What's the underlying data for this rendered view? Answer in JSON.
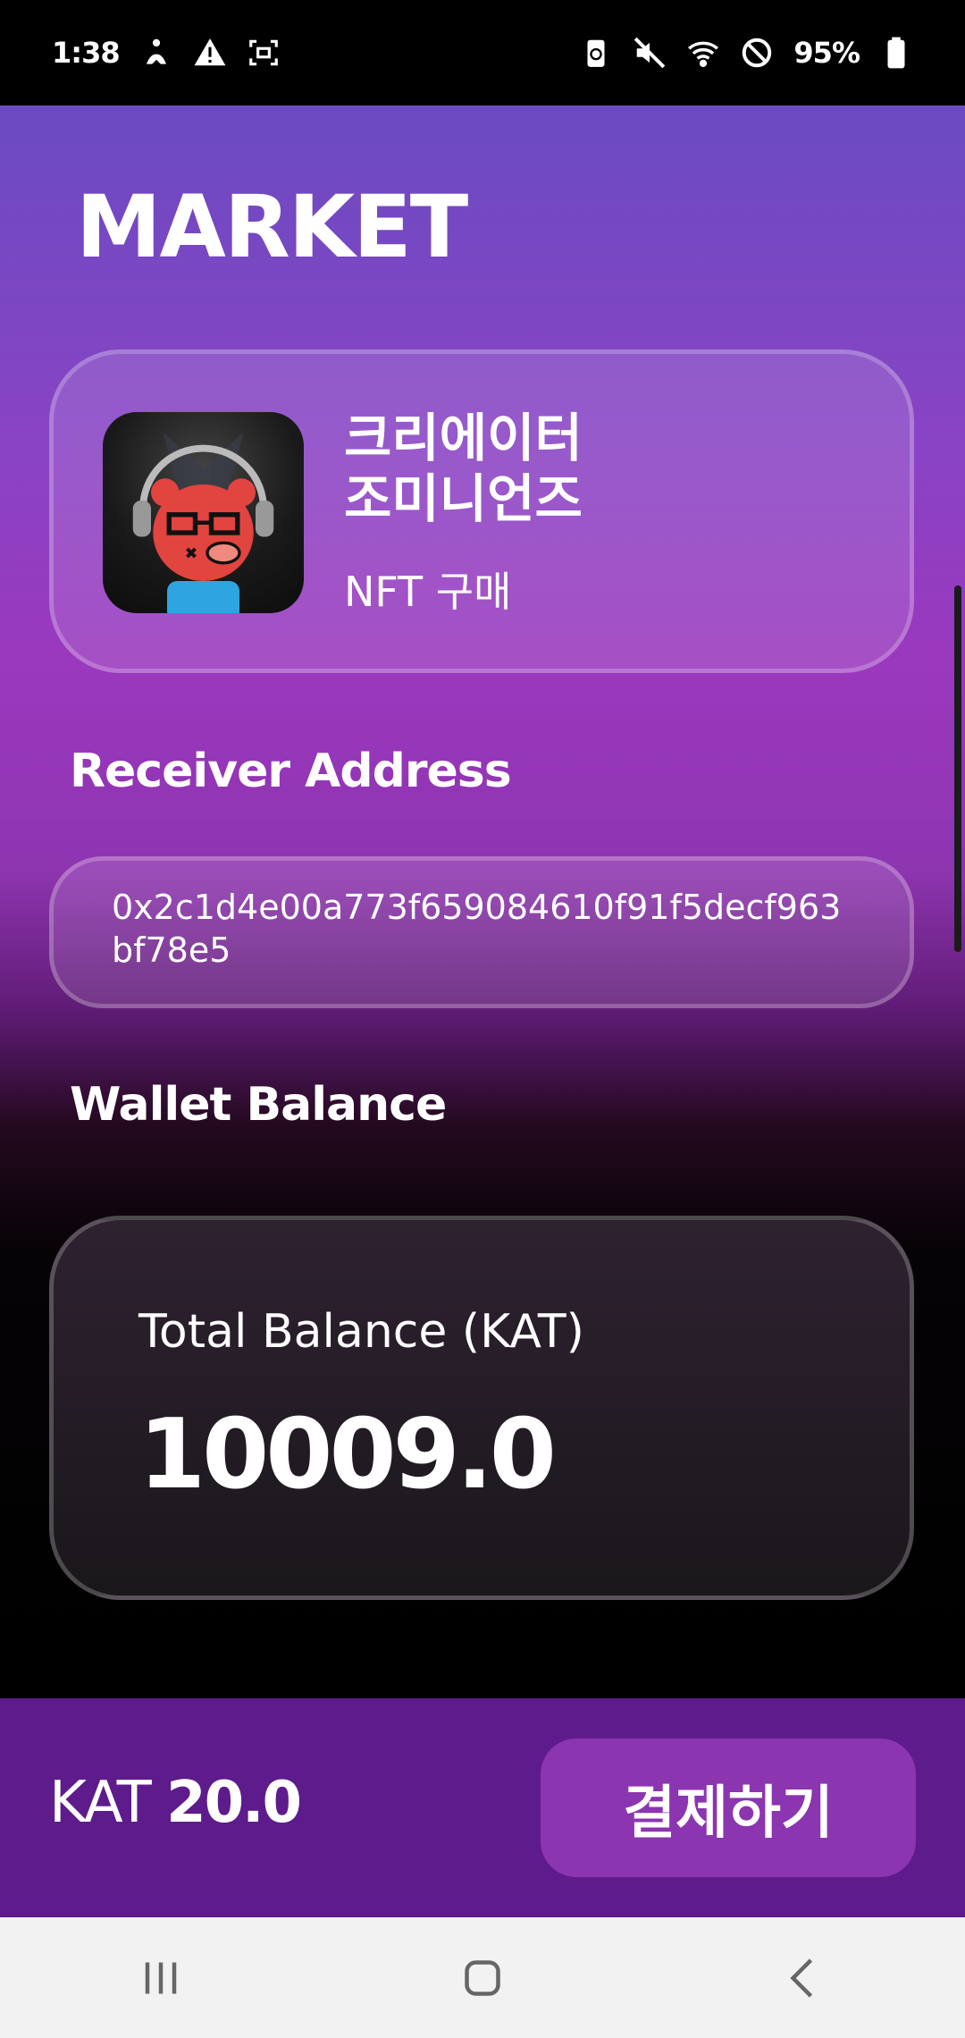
{
  "status_bar": {
    "time": "1:38",
    "battery_percent": "95%",
    "left_icons": [
      "accessibility-icon",
      "warning-icon",
      "screen-record-icon"
    ],
    "right_icons": [
      "battery-saver-icon",
      "mute-icon",
      "wifi-icon",
      "do-not-disturb-icon",
      "battery-icon"
    ]
  },
  "page": {
    "title": "MARKET"
  },
  "product": {
    "name": "크리에이터\n 조미니언즈",
    "subtitle": "NFT 구매",
    "thumbnail_icon": "bear-headphones-avatar-icon"
  },
  "receiver": {
    "label": "Receiver Address",
    "address": "0x2c1d4e00a773f659084610f91f5decf963bf78e5"
  },
  "wallet": {
    "label": "Wallet Balance",
    "caption": "Total Balance (KAT)",
    "value": "10009.0"
  },
  "checkout": {
    "currency": "KAT",
    "amount": "20.0",
    "pay_label": "결제하기"
  },
  "nav": {
    "icons": [
      "recent-apps-icon",
      "home-icon",
      "back-icon"
    ]
  },
  "colors": {
    "accent": "#5e1b8c",
    "button": "#8b35b0"
  }
}
